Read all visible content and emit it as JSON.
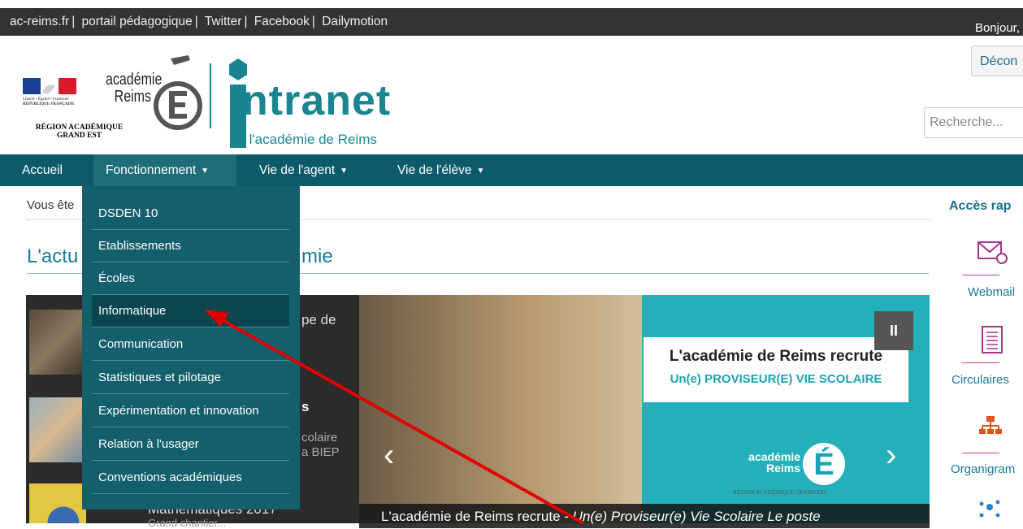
{
  "topbar": {
    "links": [
      "ac-reims.fr",
      "portail pédagogique",
      "Twitter",
      "Facebook",
      "Dailymotion"
    ],
    "separator": "|",
    "greeting": "Bonjour,"
  },
  "header": {
    "disconnect_label": "Décon",
    "search_placeholder": "Recherche...",
    "republique_lines": [
      "Liberté • Égalité • Fraternité",
      "RÉPUBLIQUE FRANÇAISE"
    ],
    "region_lines": [
      "RÉGION ACADÉMIQUE",
      "GRAND EST"
    ],
    "academie_lines": [
      "académie",
      "Reims"
    ],
    "brand": "ntranet",
    "brand_sub": "de l'académie de Reims"
  },
  "nav": {
    "items": [
      "Accueil",
      "Fonctionnement",
      "Vie de l'agent",
      "Vie de l'élève"
    ],
    "caret": "▼"
  },
  "breadcrumb": {
    "prefix": "Vous ête"
  },
  "news": {
    "heading_start": "L'actu",
    "heading_end": "mie",
    "items": [
      "pe de",
      "s",
      "colaire",
      "a BIEP",
      "Mathématiques 2017",
      "Grand chantier..."
    ]
  },
  "dropdown": {
    "items": [
      "DSDEN 10",
      "Etablissements",
      "Écoles",
      "Informatique",
      "Communication",
      "Statistiques et pilotage",
      "Expérimentation et innovation",
      "Relation à l'usager",
      "Conventions académiques"
    ],
    "highlighted_index": 3
  },
  "slider": {
    "title": "L'académie de Reims recrute",
    "subtitle": "Un(e) PROVISEUR(E) VIE SCOLAIRE",
    "pause_symbol": "II",
    "prev_symbol": "‹",
    "next_symbol": "›",
    "logo_lines": [
      "académie",
      "Reims"
    ],
    "logo_letter": "É",
    "logo_region": "RÉGION ACADÉMIQUE GRAND EST",
    "caption_plain": "L'académie de Reims recrute - ",
    "caption_italic": "Un(e) Proviseur(e) Vie Scolaire Le poste"
  },
  "rail": {
    "title": "Accès rap",
    "items": [
      "Webmail",
      "Circulaires",
      "Organigram"
    ]
  },
  "colors": {
    "topbar": "#333333",
    "nav": "#0d5a6a",
    "dropdown": "#135f6c",
    "brand": "#1a8591",
    "accent_magenta": "#c4359a",
    "arrow": "#e00000"
  }
}
